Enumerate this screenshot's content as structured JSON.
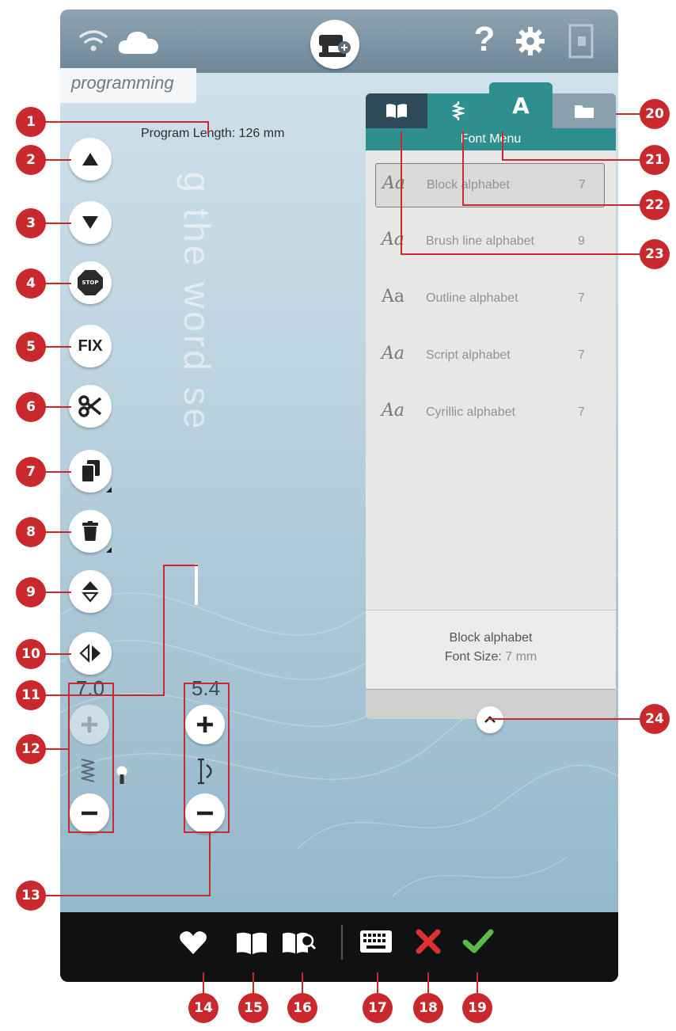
{
  "mode_label": "programming",
  "program_length": "Program Length: 126 mm",
  "font_menu": {
    "title": "Font Menu",
    "tabs": [
      "stitch-book-tab",
      "stitch-tab",
      "font-tab",
      "folder-tab"
    ],
    "fonts": [
      {
        "sample": "Aa",
        "name": "Block alphabet",
        "size": "7"
      },
      {
        "sample": "Aa",
        "name": "Brush line alphabet",
        "size": "9"
      },
      {
        "sample": "Aa",
        "name": "Outline alphabet",
        "size": "7"
      },
      {
        "sample": "Aa",
        "name": "Script alphabet",
        "size": "7"
      },
      {
        "sample": "Aa",
        "name": "Cyrillic alphabet",
        "size": "7"
      }
    ],
    "info_name": "Block alphabet",
    "info_size_label": "Font Size:",
    "info_size_value": "7 mm"
  },
  "stitch_width_value": "7.0",
  "stitch_length_value": "5.4",
  "controls": {
    "stop_label": "STOP",
    "fix_label": "FIX"
  },
  "ghost_text": "g the word se",
  "callouts": [
    "1",
    "2",
    "3",
    "4",
    "5",
    "6",
    "7",
    "8",
    "9",
    "10",
    "11",
    "12",
    "13",
    "14",
    "15",
    "16",
    "17",
    "18",
    "19",
    "20",
    "21",
    "22",
    "23",
    "24"
  ],
  "colors": {
    "callout": "#c9282d",
    "accent_teal": "#2f8e8e",
    "tab_dark": "#2c4a57",
    "confirm": "#5bbb47",
    "cancel": "#e03131"
  }
}
